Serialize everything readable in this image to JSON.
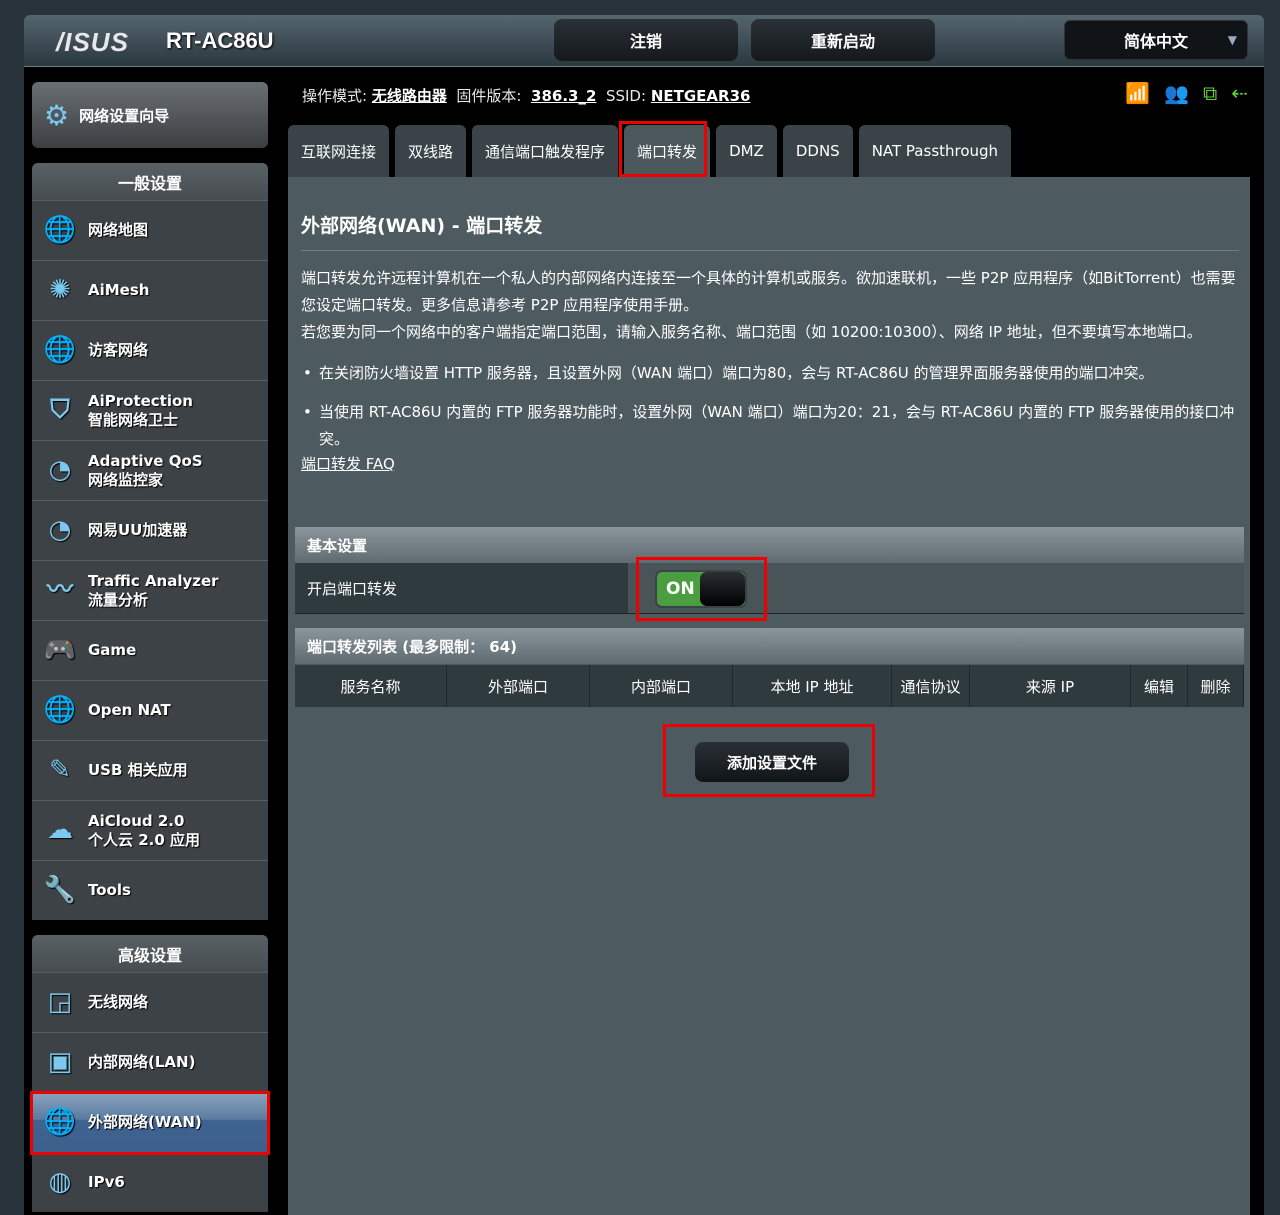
{
  "header": {
    "logo": "/ISUS",
    "model": "RT-AC86U",
    "logout": "注销",
    "reboot": "重新启动",
    "language": "简体中文"
  },
  "status": {
    "mode_label": "操作模式:",
    "mode": "无线路由器",
    "fw_label": "固件版本:",
    "fw": "386.3_2",
    "ssid_label": "SSID:",
    "ssid": "NETGEAR36"
  },
  "sidebar": {
    "wizard": "网络设置向导",
    "general_title": "一般设置",
    "general": [
      {
        "l1": "网络地图",
        "icon": "network-map-icon"
      },
      {
        "l1": "AiMesh",
        "icon": "aimesh-icon"
      },
      {
        "l1": "访客网络",
        "icon": "guest-network-icon"
      },
      {
        "l1": "AiProtection",
        "l2": "智能网络卫士",
        "icon": "shield-icon"
      },
      {
        "l1": "Adaptive QoS",
        "l2": "网络监控家",
        "icon": "gauge-icon"
      },
      {
        "l1": "网易UU加速器",
        "icon": "gauge-icon"
      },
      {
        "l1": "Traffic Analyzer",
        "l2": "流量分析",
        "icon": "traffic-icon"
      },
      {
        "l1": "Game",
        "icon": "gamepad-icon"
      },
      {
        "l1": "Open NAT",
        "icon": "open-nat-icon"
      },
      {
        "l1": "USB 相关应用",
        "icon": "usb-icon"
      },
      {
        "l1": "AiCloud 2.0",
        "l2": "个人云 2.0 应用",
        "icon": "cloud-icon"
      },
      {
        "l1": "Tools",
        "icon": "wrench-icon"
      }
    ],
    "advanced_title": "高级设置",
    "advanced": [
      {
        "l1": "无线网络",
        "icon": "wireless-icon"
      },
      {
        "l1": "内部网络(LAN)",
        "icon": "lan-icon"
      },
      {
        "l1": "外部网络(WAN)",
        "icon": "globe-icon"
      },
      {
        "l1": "IPv6",
        "icon": "ipv6-icon"
      }
    ]
  },
  "tabs": [
    "互联网连接",
    "双线路",
    "通信端口触发程序",
    "端口转发",
    "DMZ",
    "DDNS",
    "NAT Passthrough"
  ],
  "main": {
    "title": "外部网络(WAN) - 端口转发",
    "p1": "端口转发允许远程计算机在一个私人的内部网络内连接至一个具体的计算机或服务。欲加速联机，一些 P2P 应用程序（如BitTorrent）也需要您设定端口转发。更多信息请参考 P2P 应用程序使用手册。",
    "p2": "若您要为同一个网络中的客户端指定端口范围，请输入服务名称、端口范围（如 10200:10300）、网络 IP 地址，但不要填写本地端口。",
    "b1": "在关闭防火墙设置 HTTP 服务器，且设置外网（WAN 端口）端口为80，会与 RT-AC86U 的管理界面服务器使用的端口冲突。",
    "b2": "当使用 RT-AC86U 内置的 FTP 服务器功能时，设置外网（WAN 端口）端口为20：21，会与 RT-AC86U 内置的 FTP 服务器使用的接口冲突。",
    "faq": "端口转发 FAQ",
    "basic_title": "基本设置",
    "enable_label": "开启端口转发",
    "toggle": "ON",
    "list_title": "端口转发列表 (最多限制： 64)",
    "columns": [
      "服务名称",
      "外部端口",
      "内部端口",
      "本地 IP 地址",
      "通信协议",
      "来源 IP",
      "编辑",
      "删除"
    ],
    "add_button": "添加设置文件"
  }
}
